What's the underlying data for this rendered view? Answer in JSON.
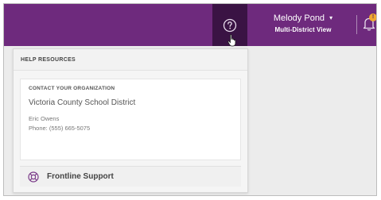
{
  "topbar": {
    "user_name": "Melody Pond",
    "user_chevron": "▾",
    "user_view": "Multi-District View",
    "notification_badge": "!",
    "help_icon": "question-circle-icon",
    "notification_icon": "bell-icon"
  },
  "help_panel": {
    "header": "HELP RESOURCES",
    "contact": {
      "title": "CONTACT YOUR ORGANIZATION",
      "organization": "Victoria County School District",
      "person": "Eric Owens",
      "phone": "Phone: (555) 665-5075"
    },
    "support": {
      "icon": "lifebuoy-icon",
      "label": "Frontline Support"
    }
  },
  "colors": {
    "topbar": "#6e2a7d",
    "help_button_active": "#3a1344",
    "badge": "#f0a830"
  }
}
